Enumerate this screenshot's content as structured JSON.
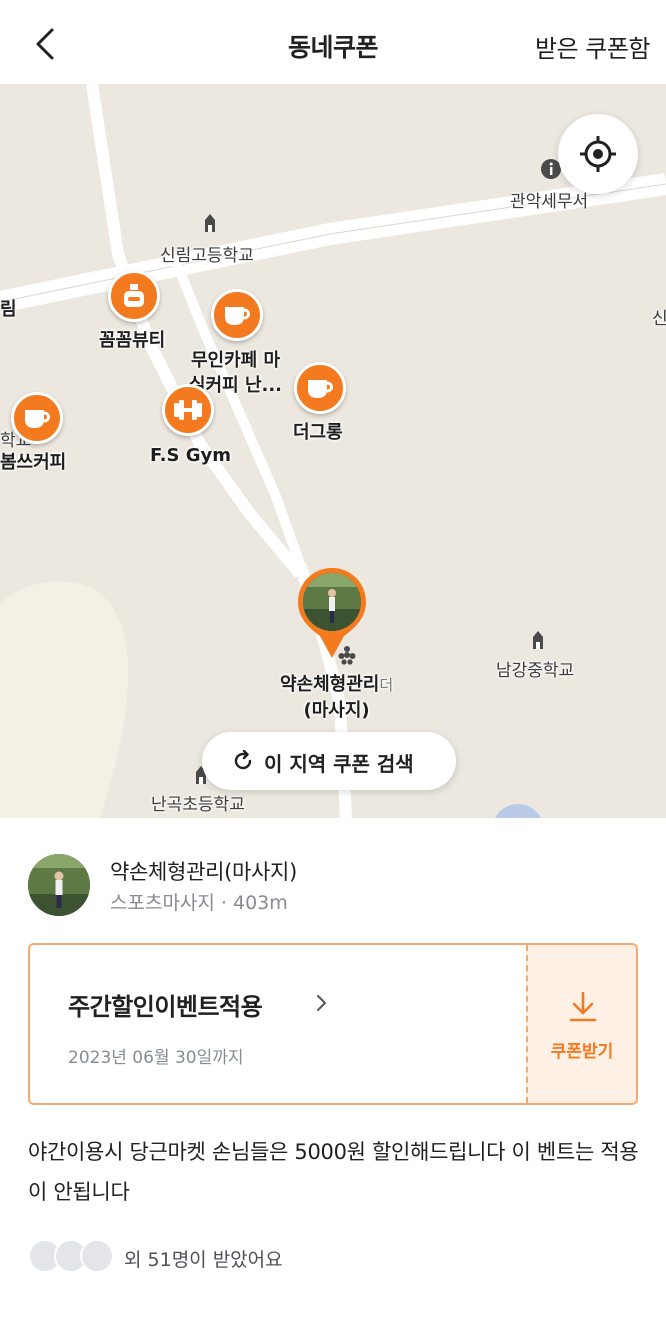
{
  "header": {
    "title": "동네쿠폰",
    "right_link": "받은 쿠폰함"
  },
  "map": {
    "labels": {
      "gwanak_tax": "관악세무서",
      "sillim_high": "신림고등학교",
      "rim": "림",
      "sin": "신",
      "kkumkkum": "꼼꼼뷰티",
      "unmanned_cafe_line1": "무인카페 마",
      "unmanned_cafe_line2": "실커피 난...",
      "deogeurong": "더그롱",
      "hakgyo": "학교",
      "bomsseu": "봄쓰커피",
      "fs_gym": "F.S Gym",
      "yakson_line1": "약손체형관리",
      "yakson_partial": "더",
      "yakson_line2": "(마사지)",
      "namgang": "남강중학교",
      "nangok": "난곡초등학교"
    },
    "search_area_label": "이 지역 쿠폰 검색"
  },
  "store": {
    "name": "약손체형관리(마사지)",
    "category": "스포츠마사지",
    "distance": "403m",
    "sub_line": "스포츠마사지 · 403m"
  },
  "coupon": {
    "title": "주간할인이벤트적용",
    "expiry": "2023년 06월 30일까지",
    "get_label": "쿠폰받기"
  },
  "description": "야간이용시 당근마켓 손님들은 5000원 할인해드립니다 이 벤트는 적용이 안됩니다",
  "receivers_label": "외 51명이 받았어요",
  "colors": {
    "accent": "#f47a20",
    "coupon_border": "#f5a96f",
    "coupon_bg": "#fff0e5",
    "map_bg": "#ece8df"
  }
}
